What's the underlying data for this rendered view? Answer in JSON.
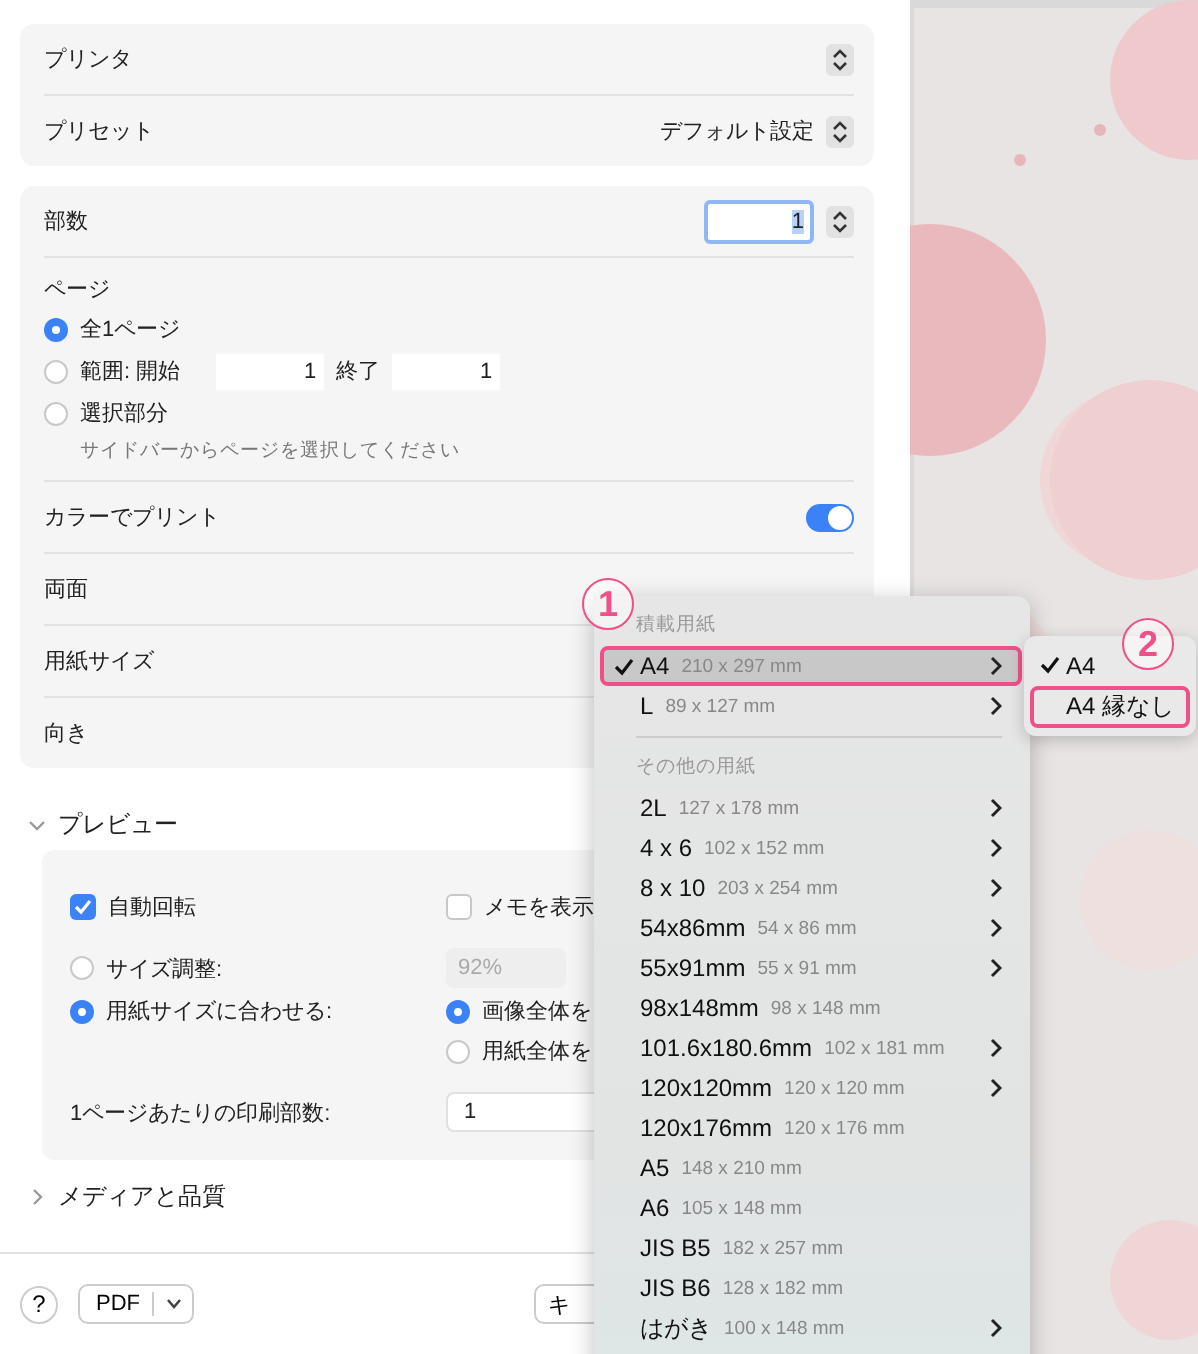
{
  "printer_card": {
    "rows": [
      {
        "label": "プリンタ"
      },
      {
        "label": "プリセット",
        "value": "デフォルト設定"
      }
    ]
  },
  "copies": {
    "label": "部数",
    "value": "1"
  },
  "pages": {
    "label": "ページ",
    "options": [
      {
        "label": "全1ページ",
        "selected": true
      },
      {
        "label": "範囲: 開始",
        "selected": false,
        "from": "1",
        "to_label": "終了",
        "to": "1"
      },
      {
        "label": "選択部分",
        "selected": false,
        "hint": "サイドバーからページを選択してください"
      }
    ]
  },
  "color_print": {
    "label": "カラーでプリント",
    "on": true
  },
  "duplex": {
    "label": "両面"
  },
  "paper_size": {
    "label": "用紙サイズ"
  },
  "orientation": {
    "label": "向き"
  },
  "preview": {
    "title": "プレビュー",
    "expanded": true,
    "auto_rotate": {
      "label": "自動回転",
      "checked": true
    },
    "show_notes": {
      "label": "メモを表示",
      "checked": false
    },
    "scale_options": [
      {
        "label": "サイズ調整:",
        "selected": false,
        "value": "92%"
      },
      {
        "label": "用紙サイズに合わせる:",
        "selected": true
      }
    ],
    "fit_options": [
      {
        "label": "画像全体を",
        "selected": true
      },
      {
        "label": "用紙全体を",
        "selected": false
      }
    ],
    "per_page": {
      "label": "1ページあたりの印刷部数:",
      "value": "1"
    }
  },
  "media_section": {
    "title": "メディアと品質",
    "expanded": false
  },
  "footer": {
    "help": "?",
    "pdf": "PDF",
    "cancel": "キ"
  },
  "menu": {
    "sections": [
      {
        "header": "積載用紙",
        "items": [
          {
            "label": "A4",
            "detail": "210 x 297 mm",
            "checked": true,
            "selected": true,
            "marked": true,
            "submenu": true
          },
          {
            "label": "L",
            "detail": "89 x 127 mm",
            "checked": false,
            "selected": false,
            "marked": false,
            "submenu": true
          }
        ]
      },
      {
        "header": "その他の用紙",
        "items": [
          {
            "label": "2L",
            "detail": "127 x 178 mm",
            "checked": false,
            "selected": false,
            "marked": false,
            "submenu": true
          },
          {
            "label": "4 x 6",
            "detail": "102 x 152 mm",
            "checked": false,
            "selected": false,
            "marked": false,
            "submenu": true
          },
          {
            "label": "8 x 10",
            "detail": "203 x 254 mm",
            "checked": false,
            "selected": false,
            "marked": false,
            "submenu": true
          },
          {
            "label": "54x86mm",
            "detail": "54 x 86 mm",
            "checked": false,
            "selected": false,
            "marked": false,
            "submenu": true
          },
          {
            "label": "55x91mm",
            "detail": "55 x 91 mm",
            "checked": false,
            "selected": false,
            "marked": false,
            "submenu": true
          },
          {
            "label": "98x148mm",
            "detail": "98 x 148 mm",
            "checked": false,
            "selected": false,
            "marked": false,
            "submenu": false
          },
          {
            "label": "101.6x180.6mm",
            "detail": "102 x 181 mm",
            "checked": false,
            "selected": false,
            "marked": false,
            "submenu": true
          },
          {
            "label": "120x120mm",
            "detail": "120 x 120 mm",
            "checked": false,
            "selected": false,
            "marked": false,
            "submenu": true
          },
          {
            "label": "120x176mm",
            "detail": "120 x 176 mm",
            "checked": false,
            "selected": false,
            "marked": false,
            "submenu": false
          },
          {
            "label": "A5",
            "detail": "148 x 210 mm",
            "checked": false,
            "selected": false,
            "marked": false,
            "submenu": false
          },
          {
            "label": "A6",
            "detail": "105 x 148 mm",
            "checked": false,
            "selected": false,
            "marked": false,
            "submenu": false
          },
          {
            "label": "JIS B5",
            "detail": "182 x 257 mm",
            "checked": false,
            "selected": false,
            "marked": false,
            "submenu": false
          },
          {
            "label": "JIS B6",
            "detail": "128 x 182 mm",
            "checked": false,
            "selected": false,
            "marked": false,
            "submenu": false
          },
          {
            "label": "はがき",
            "detail": "100 x 148 mm",
            "checked": false,
            "selected": false,
            "marked": false,
            "submenu": true
          }
        ]
      }
    ]
  },
  "submenu": {
    "items": [
      {
        "label": "A4",
        "checked": true,
        "marked": false
      },
      {
        "label": "A4 縁なし",
        "checked": false,
        "marked": true
      }
    ]
  },
  "annotations": [
    {
      "number": "1"
    },
    {
      "number": "2"
    }
  ]
}
